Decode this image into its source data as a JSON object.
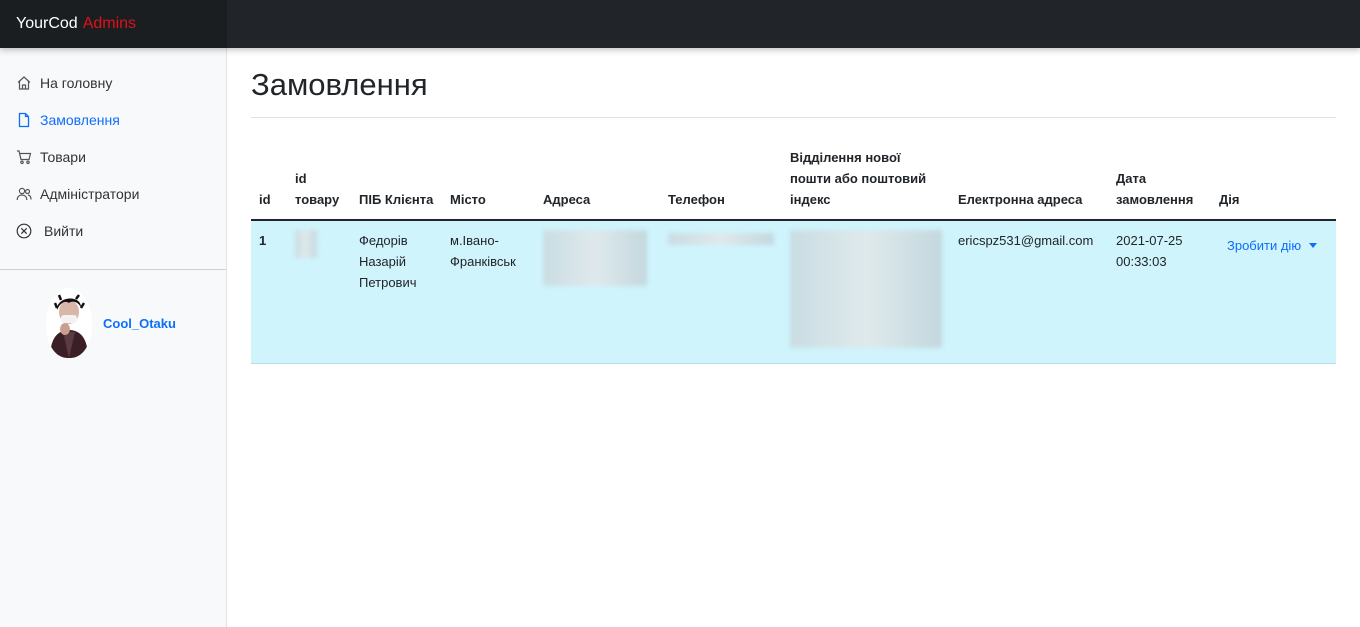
{
  "brand": {
    "name": "YourCod",
    "accent": "Admins",
    "accent_color": "#e0101c"
  },
  "sidebar": {
    "items": [
      {
        "label": "На головну",
        "icon": "home-icon",
        "active": false
      },
      {
        "label": "Замовлення",
        "icon": "file-icon",
        "active": true
      },
      {
        "label": "Товари",
        "icon": "cart-icon",
        "active": false
      },
      {
        "label": "Адміністратори",
        "icon": "users-icon",
        "active": false
      },
      {
        "label": "Вийти",
        "icon": "x-circle-icon",
        "active": false
      }
    ],
    "profile": {
      "name": "Cool_Otaku"
    }
  },
  "page": {
    "title": "Замовлення"
  },
  "table": {
    "headers": [
      "id",
      "id товару",
      "ПІБ Клієнта",
      "Місто",
      "Адреса",
      "Телефон",
      "Відділення нової пошти або поштовий індекс",
      "Електронна адреса",
      "Дата замовлення",
      "Дія"
    ],
    "rows": [
      {
        "id": "1",
        "client_name": "Федорів Назарій Петрович",
        "city": "м.Івано-Франківськ",
        "email": "ericspz531@gmail.com",
        "date": "2021-07-25 00:33:03",
        "action_label": "Зробити дію"
      }
    ]
  },
  "colors": {
    "accent": "#0d6efd",
    "row_highlight": "#cff4fc",
    "topbar": "#212529"
  }
}
